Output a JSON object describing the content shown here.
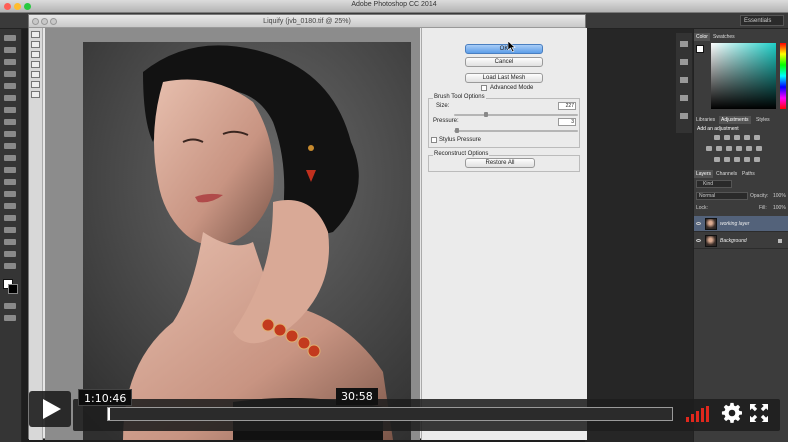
{
  "app": {
    "title": "Adobe Photoshop CC 2014",
    "workspace": "Essentials"
  },
  "liquify": {
    "title": "Liquify (jvb_0180.tif @ 25%)",
    "buttons": {
      "ok": "OK",
      "cancel": "Cancel",
      "load_last_mesh": "Load Last Mesh",
      "restore_all": "Restore All"
    },
    "advanced_mode": {
      "label": "Advanced Mode",
      "checked": false
    },
    "brush_tool_options": {
      "title": "Brush Tool Options",
      "size_label": "Size:",
      "size_value": "227",
      "pressure_label": "Pressure:",
      "pressure_value": "3",
      "stylus_label": "Stylus Pressure",
      "stylus_checked": false
    },
    "reconstruct_options": {
      "title": "Reconstruct Options"
    }
  },
  "panels": {
    "color_tabs": [
      "Color",
      "Swatches"
    ],
    "adjust_tabs": [
      "Libraries",
      "Adjustments",
      "Styles"
    ],
    "add_adjustment": "Add an adjustment",
    "layers_tabs": [
      "Layers",
      "Channels",
      "Paths"
    ],
    "kind_label": "Kind",
    "blend_mode": "Normal",
    "opacity_label": "Opacity:",
    "opacity_value": "100%",
    "lock_label": "Lock:",
    "fill_label": "Fill:",
    "fill_value": "100%",
    "layers": [
      {
        "name": "working layer",
        "selected": true
      },
      {
        "name": "Background",
        "selected": false
      }
    ]
  },
  "player": {
    "hover_time": "1:10:46",
    "current_time": "30:58",
    "progress_fraction": 0.0,
    "colors": {
      "volume": "#e0281d",
      "accent": "#5d9ee8"
    }
  }
}
